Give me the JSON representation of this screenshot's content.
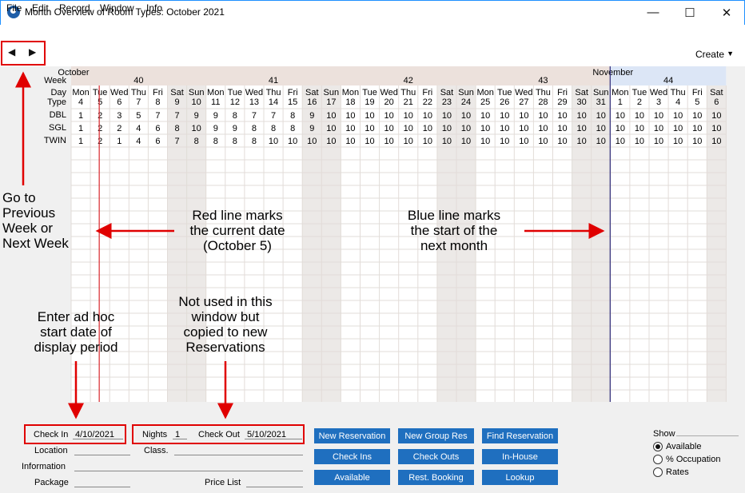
{
  "window": {
    "title": "Month Overview of Room Types: October 2021"
  },
  "menu": [
    "File",
    "Edit",
    "Record",
    "Window",
    "Info"
  ],
  "toolbar": {
    "create": "Create"
  },
  "grid": {
    "months": [
      "October",
      "November"
    ],
    "row_labels": {
      "week": "Week",
      "day": "Day",
      "type": "Type"
    },
    "weeks": [
      "40",
      "41",
      "42",
      "43",
      "44"
    ],
    "days": [
      "Mon",
      "Tue",
      "Wed",
      "Thu",
      "Fri",
      "Sat",
      "Sun",
      "Mon",
      "Tue",
      "Wed",
      "Thu",
      "Fri",
      "Sat",
      "Sun",
      "Mon",
      "Tue",
      "Wed",
      "Thu",
      "Fri",
      "Sat",
      "Sun",
      "Mon",
      "Tue",
      "Wed",
      "Thu",
      "Fri",
      "Sat",
      "Sun",
      "Mon",
      "Tue",
      "Wed",
      "Thu",
      "Fri",
      "Sat"
    ],
    "dates": [
      "4",
      "5",
      "6",
      "7",
      "8",
      "9",
      "10",
      "11",
      "12",
      "13",
      "14",
      "15",
      "16",
      "17",
      "18",
      "19",
      "20",
      "21",
      "22",
      "23",
      "24",
      "25",
      "26",
      "27",
      "28",
      "29",
      "30",
      "31",
      "1",
      "2",
      "3",
      "4",
      "5",
      "6"
    ],
    "rows": [
      {
        "type": "DBL",
        "values": [
          "1",
          "2",
          "3",
          "5",
          "7",
          "7",
          "9",
          "9",
          "8",
          "7",
          "7",
          "8",
          "9",
          "10",
          "10",
          "10",
          "10",
          "10",
          "10",
          "10",
          "10",
          "10",
          "10",
          "10",
          "10",
          "10",
          "10",
          "10",
          "10",
          "10",
          "10",
          "10",
          "10",
          "10"
        ]
      },
      {
        "type": "SGL",
        "values": [
          "1",
          "2",
          "2",
          "4",
          "6",
          "8",
          "10",
          "9",
          "9",
          "8",
          "8",
          "8",
          "9",
          "10",
          "10",
          "10",
          "10",
          "10",
          "10",
          "10",
          "10",
          "10",
          "10",
          "10",
          "10",
          "10",
          "10",
          "10",
          "10",
          "10",
          "10",
          "10",
          "10",
          "10"
        ]
      },
      {
        "type": "TWIN",
        "values": [
          "1",
          "2",
          "1",
          "4",
          "6",
          "7",
          "8",
          "8",
          "8",
          "8",
          "10",
          "10",
          "10",
          "10",
          "10",
          "10",
          "10",
          "10",
          "10",
          "10",
          "10",
          "10",
          "10",
          "10",
          "10",
          "10",
          "10",
          "10",
          "10",
          "10",
          "10",
          "10",
          "10",
          "10"
        ]
      }
    ],
    "red_value": {
      "row": 2,
      "col": 2
    },
    "colors": {
      "weekend_text": "#d9262c",
      "weekend_shade": "#ece9e7",
      "october_header": "#ece1dc",
      "november_header": "#dce6f6",
      "current_date_line": "#d9262c",
      "month_start_line": "#2d2a7a"
    }
  },
  "annotations": {
    "nav": "Go to\nPrevious\nWeek or\nNext Week",
    "red": "Red line marks\nthe current date\n(October 5)",
    "blue": "Blue line marks\nthe start of the\nnext month",
    "adhoc": "Enter ad hoc\nstart date of\ndisplay period",
    "notused": "Not used in this\nwindow but\ncopied to new\nReservations"
  },
  "form": {
    "checkin_label": "Check In",
    "checkin_value": "4/10/2021",
    "nights_label": "Nights",
    "nights_value": "1",
    "checkout_label": "Check Out",
    "checkout_value": "5/10/2021",
    "location_label": "Location",
    "class_label": "Class.",
    "information_label": "Information",
    "package_label": "Package",
    "pricelist_label": "Price List"
  },
  "buttons": [
    "New Reservation",
    "New Group Res",
    "Find Reservation",
    "Check Ins",
    "Check Outs",
    "In-House",
    "Available",
    "Rest. Booking",
    "Lookup"
  ],
  "show": {
    "label": "Show",
    "options": [
      "Available",
      "% Occupation",
      "Rates"
    ],
    "selected": "Available"
  }
}
